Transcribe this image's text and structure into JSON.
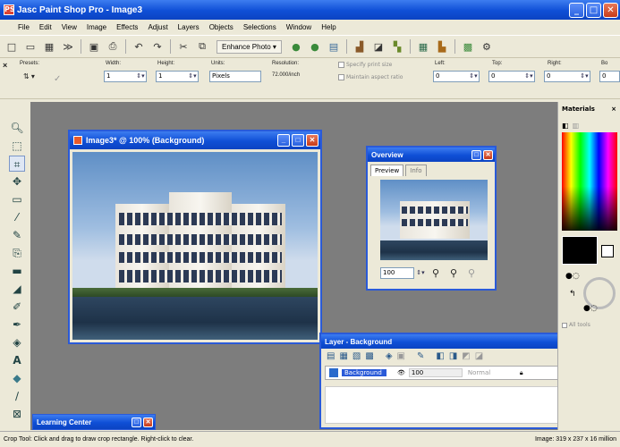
{
  "app": {
    "title": "Jasc Paint Shop Pro - Image3",
    "icon_letters": "PS"
  },
  "window_buttons": {
    "minimize": "_",
    "maximize": "□",
    "close": "✕"
  },
  "menu": [
    "File",
    "Edit",
    "View",
    "Image",
    "Effects",
    "Adjust",
    "Layers",
    "Objects",
    "Selections",
    "Window",
    "Help"
  ],
  "toolbar": {
    "enhance_label": "Enhance Photo ▾",
    "icons": [
      "new-icon",
      "open-icon",
      "browse-icon",
      "scan-icon",
      "save-icon",
      "print-icon",
      "undo-icon",
      "redo-icon",
      "cut-icon",
      "copy-icon"
    ]
  },
  "tool_options": {
    "presets_label": "Presets:",
    "width_label": "Width:",
    "width_value": "1",
    "height_label": "Height:",
    "height_value": "1",
    "units_label": "Units:",
    "units_value": "Pixels",
    "resolution_label": "Resolution:",
    "resolution_value": "72.000/inch",
    "specify_print_size": "Specify print size",
    "maintain_aspect": "Maintain aspect ratio",
    "left_label": "Left:",
    "left_value": "0",
    "top_label": "Top:",
    "top_value": "0",
    "right_label": "Right:",
    "right_value": "0",
    "bottom_label": "Bo",
    "bottom_value": "0"
  },
  "image_window": {
    "title": "Image3* @ 100% (Background)"
  },
  "overview": {
    "title": "Overview",
    "tab_preview": "Preview",
    "tab_info": "Info",
    "zoom_value": "100"
  },
  "materials": {
    "title": "Materials",
    "all_tools_label": "All tools"
  },
  "layers": {
    "title": "Layer - Background",
    "layer_name": "Background",
    "opacity": "100",
    "blend_mode": "Normal"
  },
  "learning_center": {
    "title": "Learning Center"
  },
  "status": {
    "left": "Crop Tool: Click and drag to draw crop rectangle. Right-click to clear.",
    "right": "Image: 319 x 237 x 16 million"
  },
  "colors": {
    "titlebar": "#0f4fd6",
    "workspace": "#7d7d7d",
    "chrome": "#ece9d8"
  }
}
